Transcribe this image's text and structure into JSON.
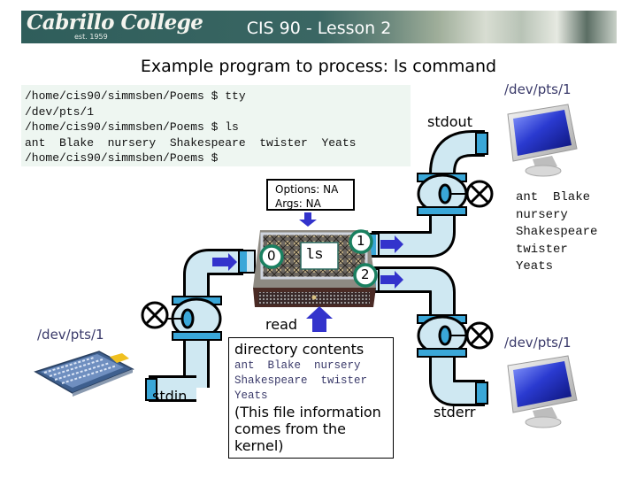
{
  "header": {
    "logo_text": "Cabrillo College",
    "logo_est": "est. 1959",
    "title": "CIS 90 - Lesson 2"
  },
  "heading": "Example program to process: ls command",
  "terminal": {
    "lines": [
      "/home/cis90/simmsben/Poems $ tty",
      "/dev/pts/1",
      "/home/cis90/simmsben/Poems $ ls",
      "ant  Blake  nursery  Shakespeare  twister  Yeats",
      "/home/cis90/simmsben/Poems $"
    ]
  },
  "diagram": {
    "program_name": "ls",
    "options_label": "Options: NA",
    "args_label": "Args: NA",
    "fd_stdin": "0",
    "fd_stdout": "1",
    "fd_stderr": "2",
    "stdin_label": "stdin",
    "stdout_label": "stdout",
    "stderr_label": "stderr",
    "read_label": "read",
    "stdin_device": "/dev/pts/1",
    "stdout_device": "/dev/pts/1",
    "stderr_device": "/dev/pts/1",
    "stdout_output": [
      "ant  Blake",
      "nursery",
      "Shakespeare",
      "twister",
      "Yeats"
    ],
    "directory_box": {
      "title": "directory contents",
      "files": [
        "ant  Blake  nursery",
        "Shakespeare  twister",
        "Yeats"
      ],
      "note": "(This file information comes from the kernel)"
    }
  },
  "colors": {
    "banner": "#2f5e5b",
    "pipe_fill": "#cfe8f2",
    "pipe_band": "#3aa7d8",
    "arrow": "#3333cc",
    "fd_ring": "#1a8060",
    "terminal_bg": "#eef6f1",
    "device_label": "#3a3a6a"
  }
}
